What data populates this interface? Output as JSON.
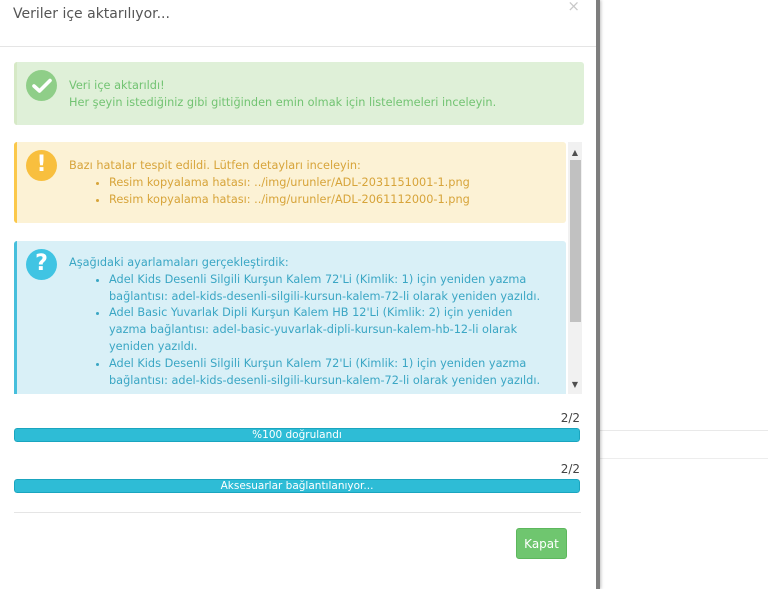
{
  "modal": {
    "title": "Veriler içe aktarılıyor...",
    "close_symbol": "×"
  },
  "success_alert": {
    "icon": "check-circle-icon",
    "title": "Veri içe aktarıldı!",
    "message": "Her şeyin istediğiniz gibi gittiğinden emin olmak için listelemeleri inceleyin."
  },
  "warning_alert": {
    "icon": "exclamation-circle-icon",
    "symbol": "!",
    "title": "Bazı hatalar tespit edildi. Lütfen detayları inceleyin:",
    "items": [
      "Resim kopyalama hatası: ../img/urunler/ADL-2031151001-1.png",
      "Resim kopyalama hatası: ../img/urunler/ADL-2061112000-1.png"
    ]
  },
  "info_alert": {
    "icon": "question-circle-icon",
    "symbol": "?",
    "title": "Aşağıdaki ayarlamaları gerçekleştirdik:",
    "items": [
      "Adel Kids Desenli Silgili Kurşun Kalem 72'Li (Kimlik: 1) için yeniden yazma bağlantısı: adel-kids-desenli-silgili-kursun-kalem-72-li olarak yeniden yazıldı.",
      "Adel Basic Yuvarlak Dipli Kurşun Kalem HB 12'Li (Kimlik: 2) için yeniden yazma bağlantısı: adel-basic-yuvarlak-dipli-kursun-kalem-hb-12-li olarak yeniden yazıldı.",
      "Adel Kids Desenli Silgili Kurşun Kalem 72'Li (Kimlik: 1) için yeniden yazma bağlantısı: adel-kids-desenli-silgili-kursun-kalem-72-li olarak yeniden yazıldı."
    ]
  },
  "progress": [
    {
      "count": "2/2",
      "label": "%100 doğrulandı",
      "percent": 100
    },
    {
      "count": "2/2",
      "label": "Aksesuarlar bağlantılanıyor...",
      "percent": 100
    }
  ],
  "footer": {
    "close_label": "Kapat"
  },
  "colors": {
    "success": "#8fce88",
    "warning": "#f8bf3e",
    "info": "#40c4e3",
    "progress": "#2ebcd6",
    "button": "#6fc66f"
  }
}
